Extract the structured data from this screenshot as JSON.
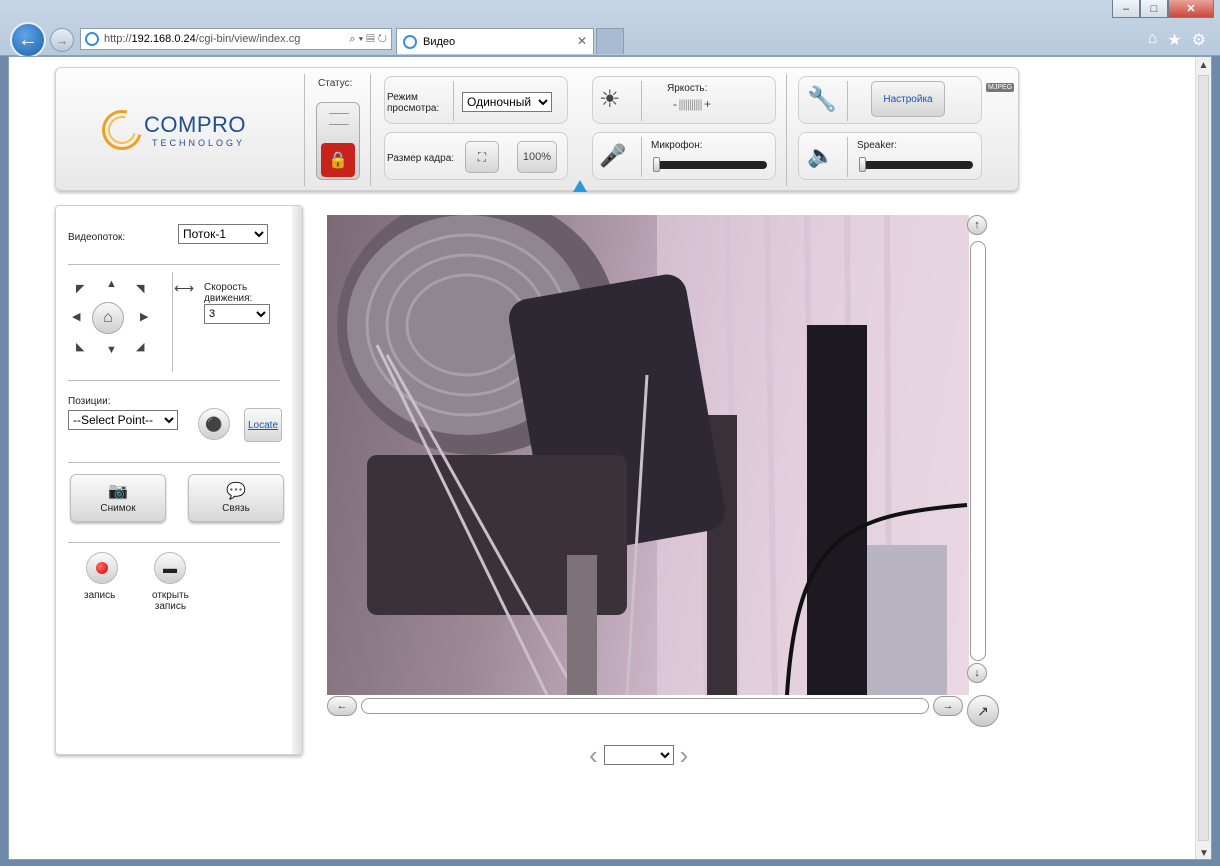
{
  "browser": {
    "url_host": "192.168.0.24",
    "url_prefix": "http://",
    "url_path": "/cgi-bin/view/index.cg",
    "tab_title": "Видео",
    "window_buttons": [
      "–",
      "□",
      "✕"
    ],
    "icons": [
      "home-icon",
      "favorites-star-icon",
      "settings-gear-icon"
    ]
  },
  "logo": {
    "name": "COMPRO",
    "sub": "TECHNOLOGY"
  },
  "toolbar": {
    "status_label": "Статус:",
    "view_mode_label_1": "Режим",
    "view_mode_label_2": "просмотра:",
    "view_mode_value": "Одиночный",
    "frame_size_label": "Размер кадра:",
    "zoom_100": "100%",
    "brightness_label": "Яркость:",
    "brightness_minus": "-",
    "brightness_plus": "+",
    "brightness_bars": "|||||||||||",
    "microphone_label": "Микрофон:",
    "settings_label": "Настройка",
    "mjpeg_badge": "MJPEG",
    "speaker_label": "Speaker:",
    "microphone_level": 0.0,
    "speaker_level": 0.0
  },
  "leftpanel": {
    "stream_label": "Видеопоток:",
    "stream_value": "Поток-1",
    "speed_label_1": "Скорость",
    "speed_label_2": "движения:",
    "speed_value": "3",
    "positions_label": "Позиции:",
    "select_point": "--Select Point--",
    "locate": "Locate",
    "snapshot": "Снимок",
    "talk": "Связь",
    "record": "запись",
    "open_record_1": "открыть",
    "open_record_2": "запись"
  },
  "pager": {
    "value": ""
  }
}
